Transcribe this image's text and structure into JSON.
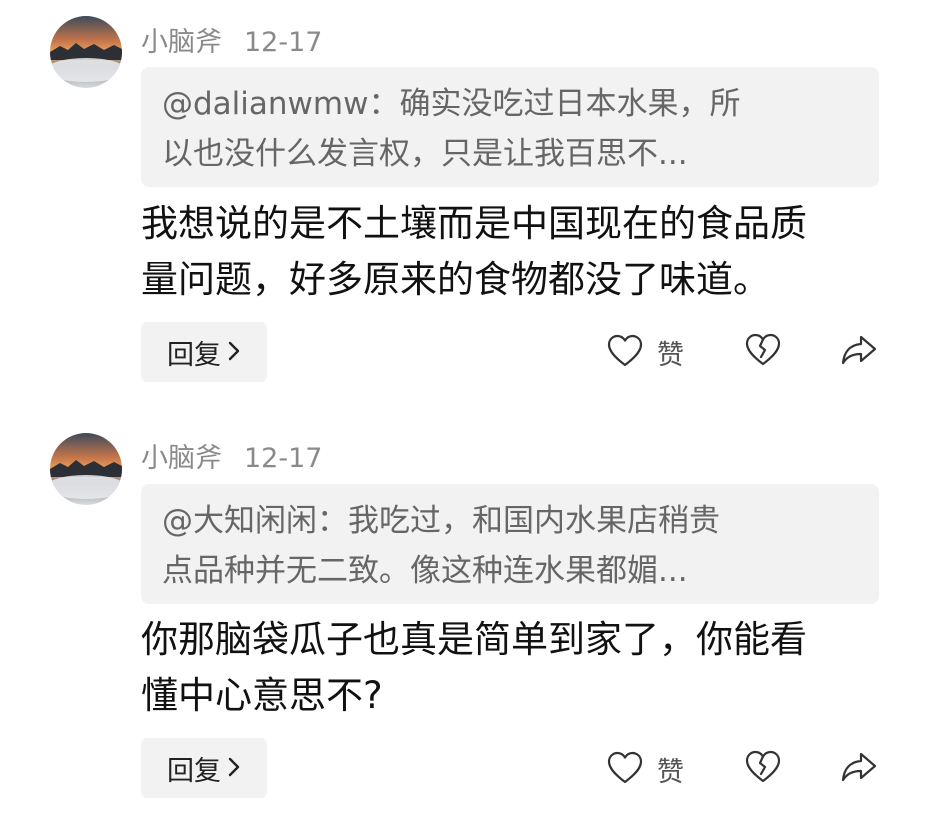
{
  "comments": [
    {
      "username": "小脑斧",
      "date": "12-17",
      "quote_lines": [
        "@dalianwmw：确实没吃过日本水果，所",
        "以也没什么发言权，只是让我百思不..."
      ],
      "body_lines": [
        "我想说的是不土壤而是中国现在的食品质",
        "量问题，好多原来的食物都没了味道。"
      ],
      "reply_label": "回复",
      "like_label": "赞"
    },
    {
      "username": "小脑斧",
      "date": "12-17",
      "quote_lines": [
        "@大知闲闲：我吃过，和国内水果店稍贵",
        "点品种并无二致。像这种连水果都媚..."
      ],
      "body_lines": [
        "你那脑袋瓜子也真是简单到家了，你能看",
        "懂中心意思不?"
      ],
      "reply_label": "回复",
      "like_label": "赞"
    }
  ],
  "icons": {
    "like": "heart-outline-icon",
    "dislike": "broken-heart-icon",
    "share": "share-arrow-icon",
    "chevron": "chevron-right-icon"
  },
  "colors": {
    "meta_text": "#8a8a8a",
    "quote_bg": "#f2f2f2",
    "quote_text": "#666666",
    "body_text": "#111111"
  }
}
